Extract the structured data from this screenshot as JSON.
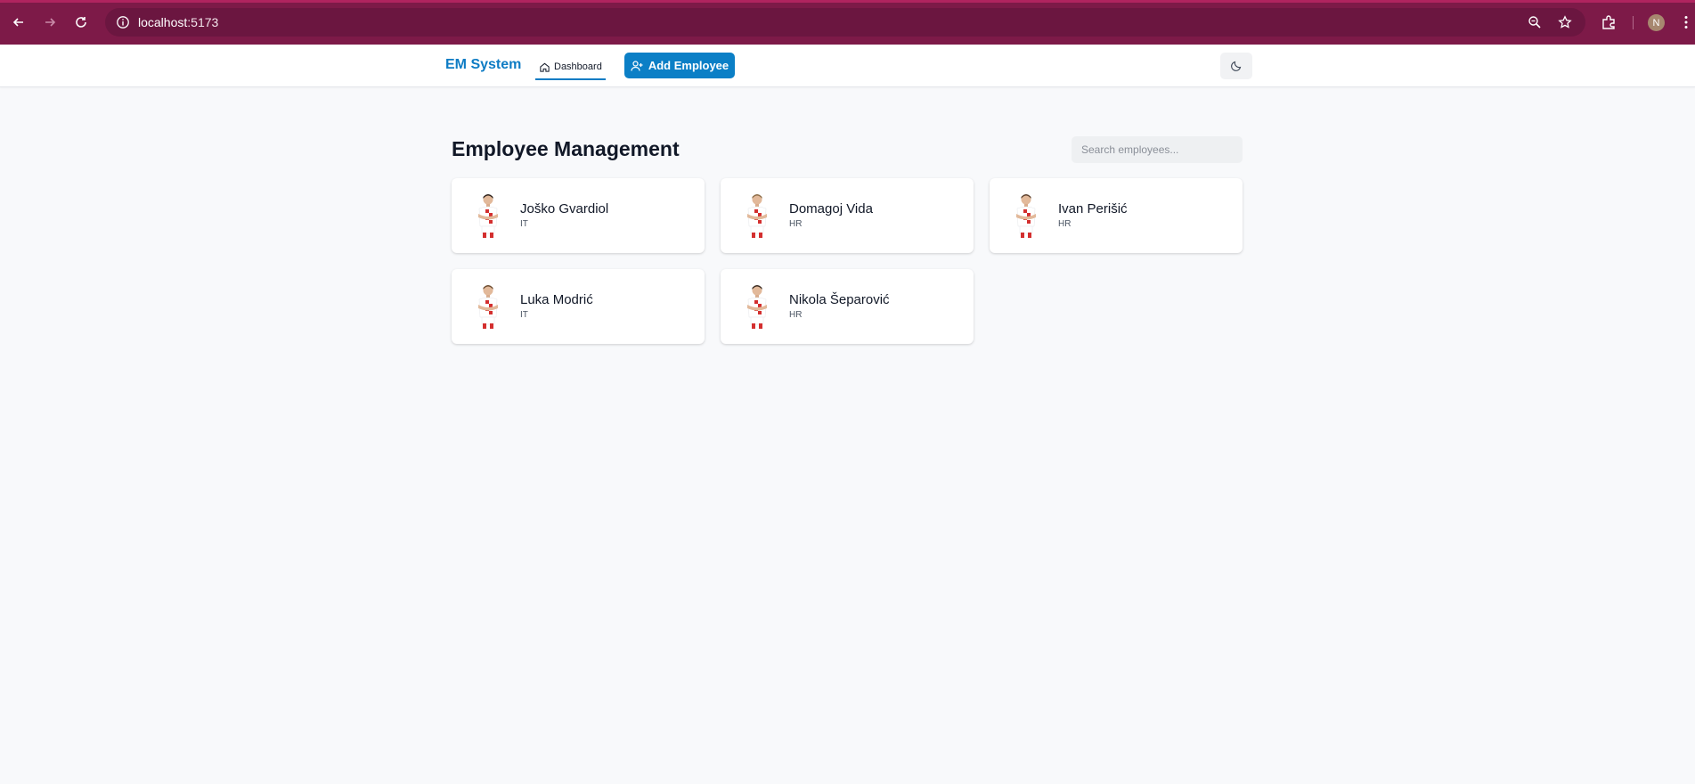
{
  "browser": {
    "url_host": "localhost",
    "url_port": ":5173",
    "profile_initial": "N"
  },
  "header": {
    "brand": "EM System",
    "nav_dashboard": "Dashboard",
    "add_employee": "Add Employee",
    "accent_color": "#0e7cc4"
  },
  "main": {
    "title": "Employee Management",
    "search_placeholder": "Search employees...",
    "employees": [
      {
        "name": "Joško Gvardiol",
        "department": "IT",
        "hair": "#2a1d17"
      },
      {
        "name": "Domagoj Vida",
        "department": "HR",
        "hair": "#8a6a45"
      },
      {
        "name": "Ivan Perišić",
        "department": "HR",
        "hair": "#5a3e2b"
      },
      {
        "name": "Luka Modrić",
        "department": "IT",
        "hair": "#6b4a2e"
      },
      {
        "name": "Nikola Šeparović",
        "department": "HR",
        "hair": "#3a2a20"
      }
    ]
  }
}
